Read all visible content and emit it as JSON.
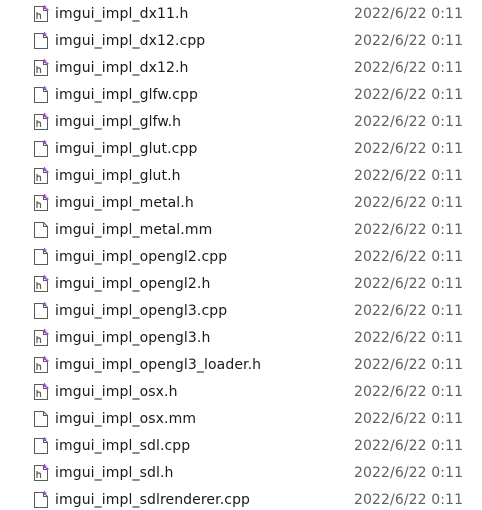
{
  "files": [
    {
      "name": "imgui_impl_dx11.h",
      "date": "2022/6/22 0:11",
      "icon": "h-file-icon"
    },
    {
      "name": "imgui_impl_dx12.cpp",
      "date": "2022/6/22 0:11",
      "icon": "cpp-file-icon"
    },
    {
      "name": "imgui_impl_dx12.h",
      "date": "2022/6/22 0:11",
      "icon": "h-file-icon"
    },
    {
      "name": "imgui_impl_glfw.cpp",
      "date": "2022/6/22 0:11",
      "icon": "cpp-file-icon"
    },
    {
      "name": "imgui_impl_glfw.h",
      "date": "2022/6/22 0:11",
      "icon": "h-file-icon"
    },
    {
      "name": "imgui_impl_glut.cpp",
      "date": "2022/6/22 0:11",
      "icon": "cpp-file-icon"
    },
    {
      "name": "imgui_impl_glut.h",
      "date": "2022/6/22 0:11",
      "icon": "h-file-icon"
    },
    {
      "name": "imgui_impl_metal.h",
      "date": "2022/6/22 0:11",
      "icon": "h-file-icon"
    },
    {
      "name": "imgui_impl_metal.mm",
      "date": "2022/6/22 0:11",
      "icon": "blank-file-icon"
    },
    {
      "name": "imgui_impl_opengl2.cpp",
      "date": "2022/6/22 0:11",
      "icon": "cpp-file-icon"
    },
    {
      "name": "imgui_impl_opengl2.h",
      "date": "2022/6/22 0:11",
      "icon": "h-file-icon"
    },
    {
      "name": "imgui_impl_opengl3.cpp",
      "date": "2022/6/22 0:11",
      "icon": "cpp-file-icon"
    },
    {
      "name": "imgui_impl_opengl3.h",
      "date": "2022/6/22 0:11",
      "icon": "h-file-icon"
    },
    {
      "name": "imgui_impl_opengl3_loader.h",
      "date": "2022/6/22 0:11",
      "icon": "h-file-icon"
    },
    {
      "name": "imgui_impl_osx.h",
      "date": "2022/6/22 0:11",
      "icon": "h-file-icon"
    },
    {
      "name": "imgui_impl_osx.mm",
      "date": "2022/6/22 0:11",
      "icon": "blank-file-icon"
    },
    {
      "name": "imgui_impl_sdl.cpp",
      "date": "2022/6/22 0:11",
      "icon": "cpp-file-icon"
    },
    {
      "name": "imgui_impl_sdl.h",
      "date": "2022/6/22 0:11",
      "icon": "h-file-icon"
    },
    {
      "name": "imgui_impl_sdlrenderer.cpp",
      "date": "2022/6/22 0:11",
      "icon": "cpp-file-icon"
    }
  ],
  "colors": {
    "text": "#1a1a1a",
    "date_text": "#5f5f5f",
    "icon_outline": "#5a5a5a",
    "icon_accent": "#9b4fd6"
  }
}
